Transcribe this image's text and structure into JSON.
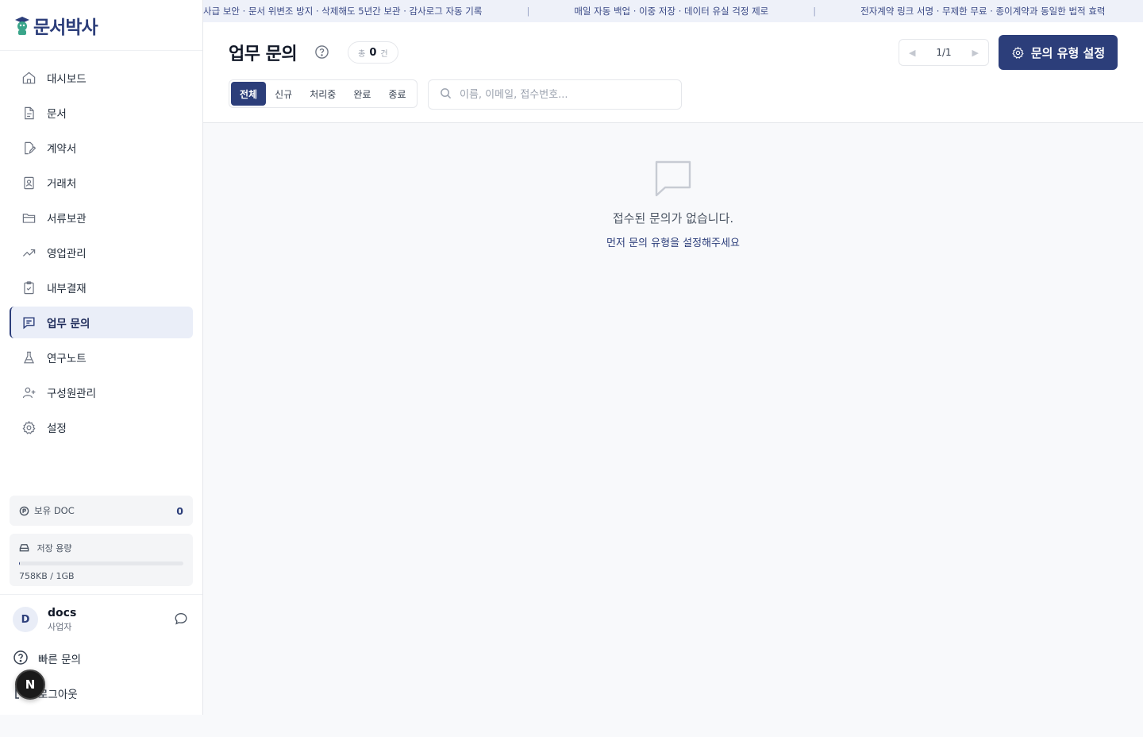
{
  "brand": {
    "name": "문서박사",
    "color": "#2c3e7a"
  },
  "sidebar": {
    "items": [
      {
        "label": "대시보드",
        "icon": "home-icon"
      },
      {
        "label": "문서",
        "icon": "document-icon"
      },
      {
        "label": "계약서",
        "icon": "contract-icon"
      },
      {
        "label": "거래처",
        "icon": "contact-card-icon"
      },
      {
        "label": "서류보관",
        "icon": "folder-icon"
      },
      {
        "label": "영업관리",
        "icon": "trending-up-icon"
      },
      {
        "label": "내부결재",
        "icon": "clipboard-check-icon"
      },
      {
        "label": "업무 문의",
        "icon": "message-square-icon",
        "active": true
      },
      {
        "label": "연구노트",
        "icon": "flask-icon"
      },
      {
        "label": "구성원관리",
        "icon": "user-plus-icon"
      },
      {
        "label": "설정",
        "icon": "gear-icon"
      }
    ],
    "doc_balance": {
      "label": "보유 DOC",
      "value": "0"
    },
    "storage": {
      "label": "저장 용량",
      "usage": "758KB / 1GB",
      "fill_fraction": 0.0007
    },
    "user": {
      "initial": "D",
      "name": "docs",
      "role": "사업자"
    },
    "quick_inquiry": "빠른 문의",
    "logout": "로그아웃",
    "dev_badge": "N"
  },
  "marquee": [
    "사급 보안 · 문서 위변조 방지 · 삭제해도 5년간 보관 · 감사로그 자동 기록",
    "매일 자동 백업 · 이중 저장 · 데이터 유실 걱정 제로",
    "전자계약 링크 서명 · 무제한 무료 · 종이계약과 동일한 법적 효력"
  ],
  "header": {
    "title": "업무 문의",
    "count_prefix": "총",
    "count": "0",
    "count_suffix": "건",
    "pager": "1/1",
    "settings_button": "문의 유형 설정"
  },
  "tabs": [
    "전체",
    "신규",
    "처리중",
    "완료",
    "종료"
  ],
  "search": {
    "placeholder": "이름, 이메일, 접수번호...",
    "value": ""
  },
  "empty_state": {
    "title": "접수된 문의가 없습니다.",
    "subtitle": "먼저 문의 유형을 설정해주세요"
  }
}
